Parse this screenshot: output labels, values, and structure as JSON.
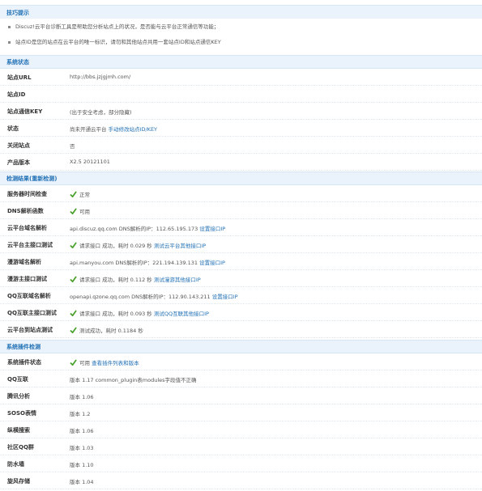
{
  "tips": {
    "title": "技巧提示",
    "items": [
      "Discuz!云平台诊断工具是帮助您分析站点上的状况，是否能与云平台正常通信等功能；",
      "站点ID是您的站点在云平台的唯一标识，请勿和其他站点共用一套站点ID和站点通信KEY"
    ]
  },
  "system": {
    "title": "系统状态",
    "rows": [
      {
        "key": "站点URL",
        "value": "http://bbs.jzjgjmh.com/"
      },
      {
        "key": "站点ID",
        "value": ""
      },
      {
        "key": "站点通信KEY",
        "value": "(出于安全考虑，部分隐藏)"
      },
      {
        "key": "状态",
        "value": "尚未开通云平台",
        "link": "手动修改站点ID/KEY"
      },
      {
        "key": "关闭站点",
        "value": "否"
      },
      {
        "key": "产品版本",
        "value": "X2.5 20121101"
      }
    ]
  },
  "check": {
    "title": "检测结果(重新检测)",
    "rows": [
      {
        "key": "服务器时间检查",
        "check": true,
        "value": "正常"
      },
      {
        "key": "DNS解析函数",
        "check": true,
        "value": "可用"
      },
      {
        "key": "云平台域名解析",
        "check": false,
        "value": "api.discuz.qq.com DNS解析的IP：112.65.195.173",
        "link": "设置接口IP"
      },
      {
        "key": "云平台主接口测试",
        "check": true,
        "value": "请求接口 成功，耗时 0.029 秒",
        "link": "测试云平台其他接口IP"
      },
      {
        "key": "漫游域名解析",
        "check": false,
        "value": "api.manyou.com DNS解析的IP：221.194.139.131",
        "link": "设置接口IP"
      },
      {
        "key": "漫游主接口测试",
        "check": true,
        "value": "请求接口 成功，耗时 0.112 秒",
        "link": "测试漫游其他接口IP"
      },
      {
        "key": "QQ互联域名解析",
        "check": false,
        "value": "openapi.qzone.qq.com DNS解析的IP：112.90.143.211",
        "link": "设置接口IP"
      },
      {
        "key": "QQ互联主接口测试",
        "check": true,
        "value": "请求接口 成功，耗时 0.093 秒",
        "link": "测试QQ互联其他接口IP"
      },
      {
        "key": "云平台到站点测试",
        "check": true,
        "value": "测试成功，耗时 0.1184 秒"
      }
    ]
  },
  "plugins": {
    "title": "系统插件检测",
    "rows": [
      {
        "key": "系统插件状态",
        "check": true,
        "value": "可用",
        "link": "查看插件列表和版本"
      },
      {
        "key": "QQ互联",
        "check": false,
        "value": "版本 1.17 common_plugin表modules字段值不正确"
      },
      {
        "key": "腾讯分析",
        "check": false,
        "value": "版本 1.06"
      },
      {
        "key": "SOSO表情",
        "check": false,
        "value": "版本 1.2"
      },
      {
        "key": "纵横搜索",
        "check": false,
        "value": "版本 1.06"
      },
      {
        "key": "社区QQ群",
        "check": false,
        "value": "版本 1.03"
      },
      {
        "key": "防水墙",
        "check": false,
        "value": "版本 1.10"
      },
      {
        "key": "旋风存储",
        "check": false,
        "value": "版本 1.04"
      }
    ]
  },
  "colors": {
    "accent": "#1f6fb5",
    "header_bg": "#eaf3fb",
    "check": "#4aa02c"
  }
}
